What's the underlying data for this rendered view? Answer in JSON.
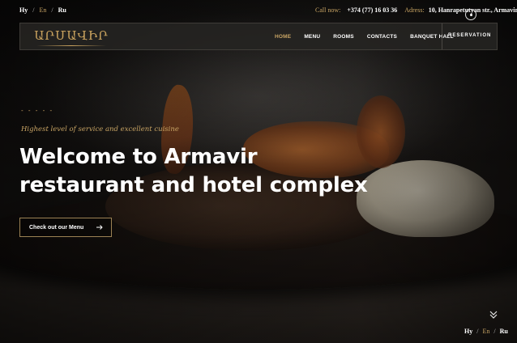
{
  "languages": [
    {
      "code": "Hy",
      "active": false
    },
    {
      "code": "En",
      "active": true
    },
    {
      "code": "Ru",
      "active": false
    }
  ],
  "separator": "/",
  "contact": {
    "call_label": "Call now:",
    "phone": "+374 (77) 16 03 36",
    "address_label": "Adress:",
    "address": "10, Hanrapetutyan str., Armavir"
  },
  "logo_text": "ԱՐՄԱՎԻՐ",
  "nav": [
    "HOME",
    "MENU",
    "ROOMS",
    "CONTACTS",
    "BANQUET HALL"
  ],
  "reservation_label": "RESERVATION",
  "hero": {
    "dashes": "- - - - -",
    "tagline": "Highest level of service and excellent cuisine",
    "title_line1": "Welcome to Armavir",
    "title_line2": "restaurant and hotel complex",
    "cta_label": "Check out our Menu"
  },
  "colors": {
    "accent": "#c8a464",
    "text": "#ffffff",
    "header_bg": "#262422"
  },
  "icons": {
    "cta": "arrow-right-icon",
    "scroll": "double-chevron-down-icon",
    "location": "location-pin-icon"
  }
}
